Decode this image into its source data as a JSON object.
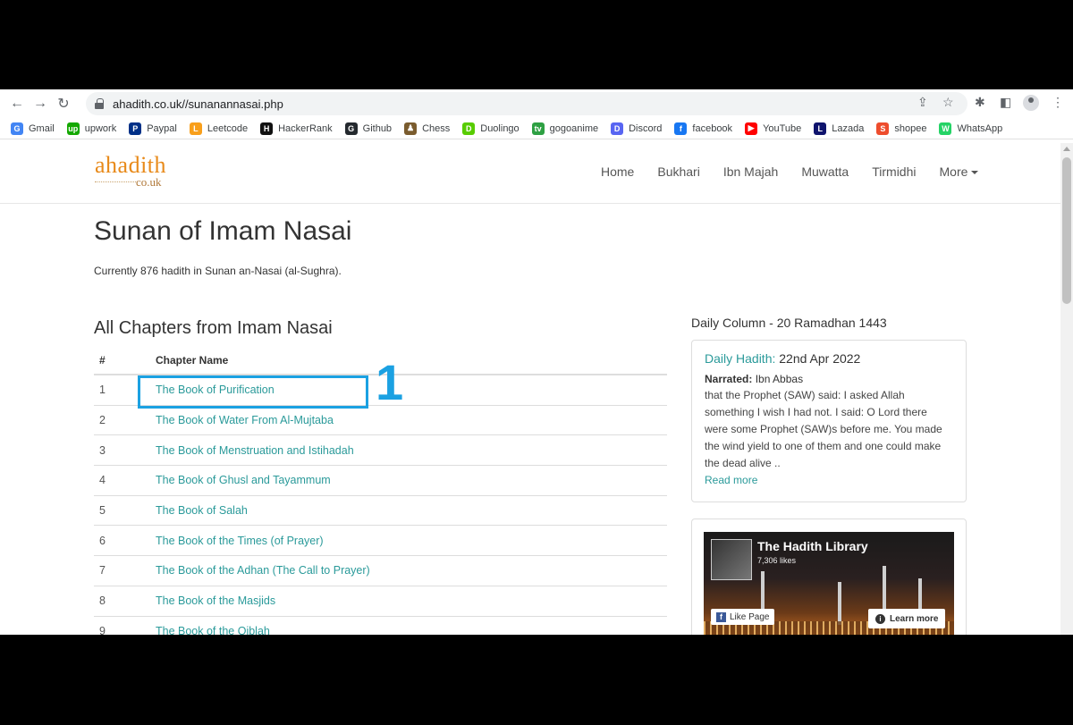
{
  "browser": {
    "url": "ahadith.co.uk//sunanannasai.php",
    "bookmarks": [
      {
        "label": "Gmail",
        "icon": "google-icon",
        "color": "#4285f4",
        "glyph": "G"
      },
      {
        "label": "upwork",
        "icon": "upwork-icon",
        "color": "#14a800",
        "glyph": "up"
      },
      {
        "label": "Paypal",
        "icon": "paypal-icon",
        "color": "#003087",
        "glyph": "P"
      },
      {
        "label": "Leetcode",
        "icon": "leetcode-icon",
        "color": "#f89f1b",
        "glyph": "L"
      },
      {
        "label": "HackerRank",
        "icon": "hackerrank-icon",
        "color": "#111111",
        "glyph": "H"
      },
      {
        "label": "Github",
        "icon": "github-icon",
        "color": "#24292e",
        "glyph": "G"
      },
      {
        "label": "Chess",
        "icon": "chess-icon",
        "color": "#7a5c2e",
        "glyph": "♟"
      },
      {
        "label": "Duolingo",
        "icon": "duolingo-icon",
        "color": "#58cc02",
        "glyph": "D"
      },
      {
        "label": "gogoanime",
        "icon": "gogoanime-icon",
        "color": "#2ea043",
        "glyph": "tv"
      },
      {
        "label": "Discord",
        "icon": "discord-icon",
        "color": "#5865f2",
        "glyph": "D"
      },
      {
        "label": "facebook",
        "icon": "facebook-icon",
        "color": "#1877f2",
        "glyph": "f"
      },
      {
        "label": "YouTube",
        "icon": "youtube-icon",
        "color": "#ff0000",
        "glyph": "▶"
      },
      {
        "label": "Lazada",
        "icon": "lazada-icon",
        "color": "#0f146d",
        "glyph": "L"
      },
      {
        "label": "shopee",
        "icon": "shopee-icon",
        "color": "#ee4d2d",
        "glyph": "S"
      },
      {
        "label": "WhatsApp",
        "icon": "whatsapp-icon",
        "color": "#25d366",
        "glyph": "W"
      }
    ]
  },
  "site": {
    "logo": {
      "main": "ahadith",
      "sub": "co.uk"
    },
    "nav": [
      {
        "label": "Home",
        "name": "nav-home"
      },
      {
        "label": "Bukhari",
        "name": "nav-bukhari"
      },
      {
        "label": "Ibn Majah",
        "name": "nav-ibn-majah"
      },
      {
        "label": "Muwatta",
        "name": "nav-muwatta"
      },
      {
        "label": "Tirmidhi",
        "name": "nav-tirmidhi"
      }
    ],
    "nav_more": "More"
  },
  "main": {
    "title": "Sunan of Imam Nasai",
    "subtitle": "Currently 876 hadith in Sunan an-Nasai (al-Sughra).",
    "chapters_title": "All Chapters from Imam Nasai",
    "table_headers": {
      "num": "#",
      "name": "Chapter Name"
    },
    "chapters": [
      {
        "num": "1",
        "name": "The Book of Purification"
      },
      {
        "num": "2",
        "name": "The Book of Water From Al-Mujtaba"
      },
      {
        "num": "3",
        "name": "The Book of Menstruation and Istihadah"
      },
      {
        "num": "4",
        "name": "The Book of Ghusl and Tayammum"
      },
      {
        "num": "5",
        "name": "The Book of Salah"
      },
      {
        "num": "6",
        "name": "The Book of the Times (of Prayer)"
      },
      {
        "num": "7",
        "name": "The Book of the Adhan (The Call to Prayer)"
      },
      {
        "num": "8",
        "name": "The Book of the Masjids"
      },
      {
        "num": "9",
        "name": "The Book of the Qiblah"
      }
    ],
    "annotation_number": "1"
  },
  "sidebar": {
    "column_title": "Daily Column - 20 Ramadhan 1443",
    "daily_label": "Daily Hadith:",
    "daily_date": "22nd Apr 2022",
    "narrated_label": "Narrated:",
    "narrator": "Ibn Abbas",
    "text": "that the Prophet (SAW) said: I asked Allah something I wish I had not. I said: O Lord there were some Prophet (SAW)s before me. You made the wind yield to one of them and one could make the dead alive ..",
    "read_more": "Read more",
    "fb": {
      "page_name": "The Hadith Library",
      "likes": "7,306 likes",
      "like_btn": "Like Page",
      "learn_btn": "Learn more"
    }
  }
}
